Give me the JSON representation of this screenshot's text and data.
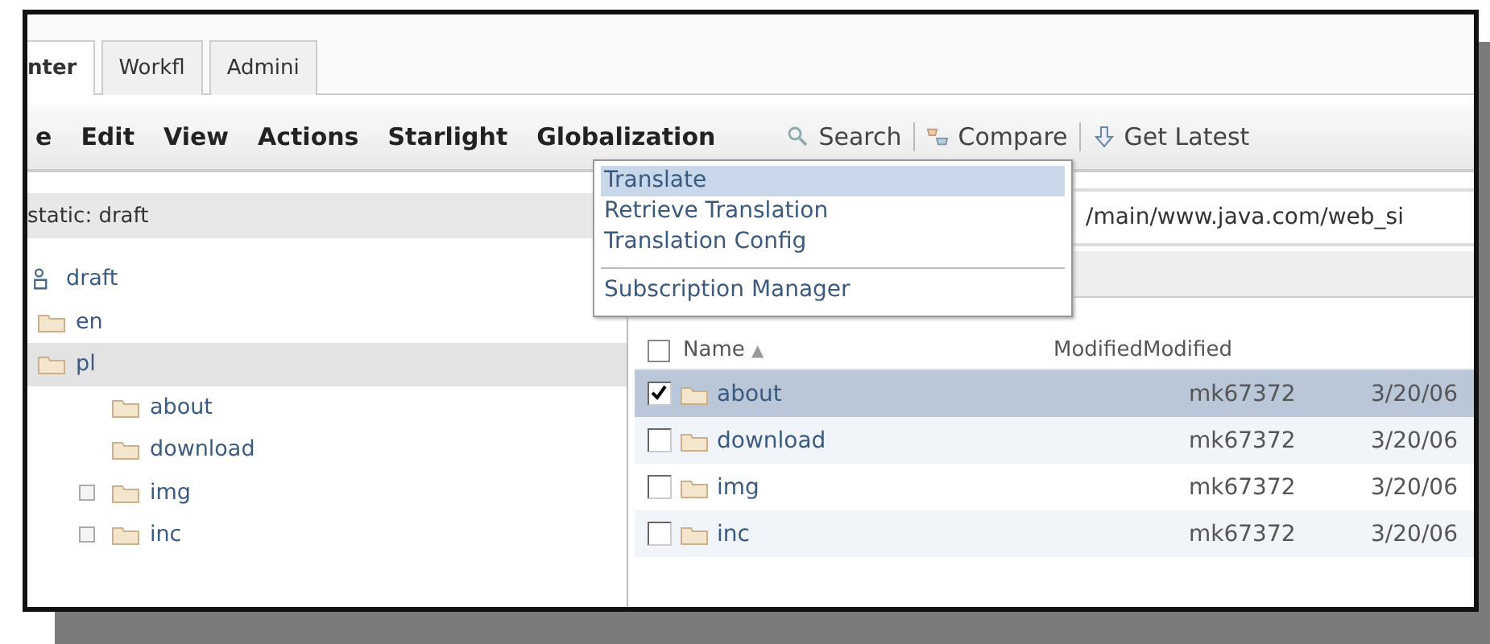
{
  "tabs": [
    {
      "label": "nter",
      "selected": true
    },
    {
      "label": "Workfl",
      "selected": false
    },
    {
      "label": "Admini",
      "selected": false
    }
  ],
  "menubar": [
    "e",
    "Edit",
    "View",
    "Actions",
    "Starlight",
    "Globalization"
  ],
  "toolbar": [
    {
      "label": "Search",
      "kind": "search"
    },
    {
      "label": "Compare",
      "kind": "compare"
    },
    {
      "label": "Get Latest",
      "kind": "download"
    }
  ],
  "dropdown": [
    {
      "label": "Translate",
      "selected": true,
      "kind": "item"
    },
    {
      "label": "Retrieve Translation",
      "selected": false,
      "kind": "item"
    },
    {
      "label": "Translation Config",
      "selected": false,
      "kind": "item"
    },
    {
      "label": "Subscription Manager",
      "selected": false,
      "kind": "item",
      "separator_before": true
    }
  ],
  "tree": {
    "header": "static: draft",
    "items": [
      {
        "label": "draft",
        "kind": "workarea",
        "toggle": false,
        "selected": false,
        "children": [
          {
            "label": "en",
            "kind": "folder",
            "toggle": false,
            "selected": false
          },
          {
            "label": "pl",
            "kind": "folder",
            "toggle": false,
            "selected": true,
            "children": [
              {
                "label": "about",
                "kind": "folder",
                "toggle": false,
                "selected": false
              },
              {
                "label": "download",
                "kind": "folder",
                "toggle": false,
                "selected": false
              },
              {
                "label": "img",
                "kind": "folder",
                "toggle": true,
                "selected": false
              },
              {
                "label": "inc",
                "kind": "folder",
                "toggle": true,
                "selected": false
              }
            ]
          }
        ]
      }
    ]
  },
  "path": "/main/www.java.com/web_si",
  "table": {
    "columns": [
      "Name",
      "ModifiedModified"
    ],
    "sort_mark": "▲",
    "all_checked": false,
    "rows": [
      {
        "name": "about",
        "column_2": "mk67372",
        "column_3": "3/20/06",
        "checked": true,
        "selected": true
      },
      {
        "name": "download",
        "column_2": "mk67372",
        "column_3": "3/20/06",
        "checked": false,
        "selected": false
      },
      {
        "name": "img",
        "column_2": "mk67372",
        "column_3": "3/20/06",
        "checked": false,
        "selected": false
      },
      {
        "name": "inc",
        "column_2": "mk67372",
        "column_3": "3/20/06",
        "checked": false,
        "selected": false
      }
    ]
  }
}
